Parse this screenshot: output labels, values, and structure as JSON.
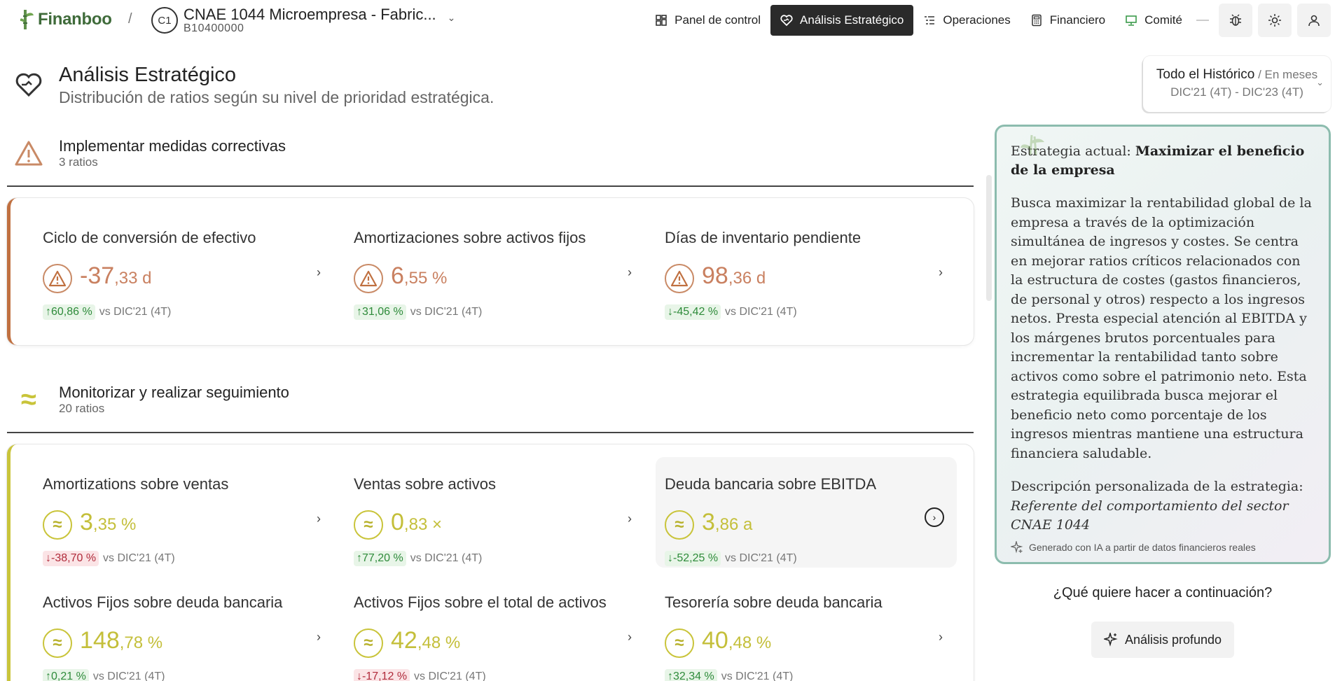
{
  "brand": {
    "name": "Finanboo"
  },
  "breadcrumb": {
    "separator": "/"
  },
  "company": {
    "badge": "C1",
    "name": "CNAE 1044 Microempresa - Fabric...",
    "code": "B10400000"
  },
  "nav": {
    "items": [
      {
        "label": "Panel de control",
        "icon": "grid-icon"
      },
      {
        "label": "Análisis Estratégico",
        "icon": "heart-icon",
        "active": true
      },
      {
        "label": "Operaciones",
        "icon": "list-icon"
      },
      {
        "label": "Financiero",
        "icon": "calculator-icon"
      },
      {
        "label": "Comité",
        "icon": "monitor-icon"
      }
    ]
  },
  "page": {
    "title": "Análisis Estratégico",
    "subtitle": "Distribución de ratios según su nivel de prioridad estratégica."
  },
  "period": {
    "label": "Todo el Histórico",
    "suffix": " / En meses",
    "range": "DIC'21 (4T) - DIC'23 (4T)"
  },
  "sections": [
    {
      "title": "Implementar medidas correctivas",
      "count": "3 ratios",
      "color": "#c07040",
      "metrics": [
        {
          "title": "Ciclo de conversión de efectivo",
          "int": "-37",
          "dec": ",33",
          "unit": " d",
          "delta": "60,86 %",
          "arrow": "↑",
          "vs": "vs DIC'21 (4T)"
        },
        {
          "title": "Amortizaciones sobre activos fijos",
          "int": "6",
          "dec": ",55",
          "unit": " %",
          "delta": "31,06 %",
          "arrow": "↑",
          "vs": "vs DIC'21 (4T)"
        },
        {
          "title": "Días de inventario pendiente",
          "int": "98",
          "dec": ",36",
          "unit": " d",
          "delta": "-45,42 %",
          "arrow": "↓",
          "vs": "vs DIC'21 (4T)"
        }
      ]
    },
    {
      "title": "Monitorizar y realizar seguimiento",
      "count": "20 ratios",
      "color": "#c9c43a",
      "metrics": [
        {
          "title": "Amortizations sobre ventas",
          "int": "3",
          "dec": ",35",
          "unit": " %",
          "delta": "-38,70 %",
          "arrow": "↓",
          "vs": "vs DIC'21 (4T)"
        },
        {
          "title": "Ventas sobre activos",
          "int": "0",
          "dec": ",83",
          "unit": " ×",
          "delta": "77,20 %",
          "arrow": "↑",
          "vs": "vs DIC'21 (4T)"
        },
        {
          "title": "Deuda bancaria sobre EBITDA",
          "int": "3",
          "dec": ",86",
          "unit": " a",
          "delta": "-52,25 %",
          "arrow": "↓",
          "vs": "vs DIC'21 (4T)"
        },
        {
          "title": "Activos Fijos sobre deuda bancaria",
          "int": "148",
          "dec": ",78",
          "unit": " %",
          "delta": "0,21 %",
          "arrow": "↑",
          "vs": "vs DIC'21 (4T)"
        },
        {
          "title": "Activos Fijos sobre el total de activos",
          "int": "42",
          "dec": ",48",
          "unit": " %",
          "delta": "-17,12 %",
          "arrow": "↓",
          "vs": "vs DIC'21 (4T)"
        },
        {
          "title": "Tesorería sobre deuda bancaria",
          "int": "40",
          "dec": ",48",
          "unit": " %",
          "delta": "32,34 %",
          "arrow": "↑",
          "vs": "vs DIC'21 (4T)"
        }
      ]
    }
  ],
  "strategy": {
    "lead_label": "Estrategia actual: ",
    "lead_value": "Maximizar el beneficio de la empresa",
    "body": "Busca maximizar la rentabilidad global de la empresa a través de la optimización simultánea de ingresos y costes. Se centra en mejorar ratios críticos relacionados con la estructura de costes (gastos financieros, de personal y otros) respecto a los ingresos netos. Presta especial atención al EBITDA y los márgenes brutos porcentuales para incrementar la rentabilidad tanto sobre activos como sobre el patrimonio neto. Esta estrategia equilibrada busca mejorar el beneficio neto como porcentaje de los ingresos mientras mantiene una estructura financiera saludable.",
    "desc_label": "Descripción personalizada de la estrategia:",
    "desc_value": "Referente del comportamiento del sector CNAE 1044",
    "footer": "Generado con IA a partir de datos financieros reales",
    "border_color": "#8cbcae"
  },
  "next": {
    "question": "¿Qué quiere hacer a continuación?",
    "deep_analysis": "Análisis profundo"
  }
}
